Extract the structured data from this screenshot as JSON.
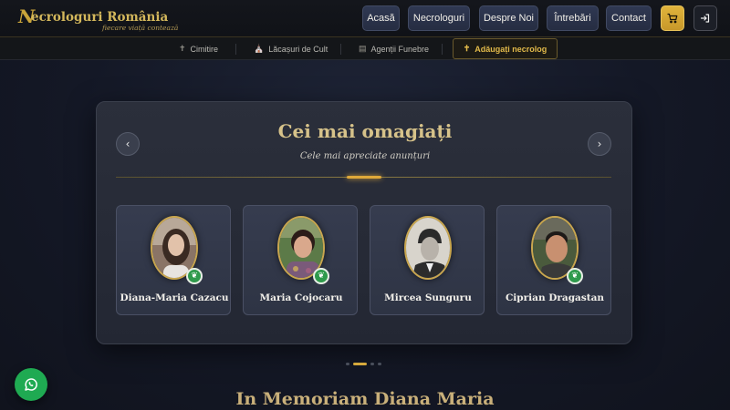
{
  "brand": {
    "initial": "N",
    "title": "ecrologuri România",
    "tagline": "fiecare viață contează"
  },
  "nav": {
    "items": [
      "Acasă",
      "Necrologuri",
      "Despre Noi",
      "Întrebări",
      "Contact"
    ]
  },
  "subnav": {
    "items": [
      {
        "label": "Cimitire",
        "icon": "cross-icon"
      },
      {
        "label": "Lăcașuri de Cult",
        "icon": "church-icon"
      },
      {
        "label": "Agenții Funebre",
        "icon": "building-icon"
      }
    ],
    "cta": {
      "label": "Adăugați necrolog",
      "icon": "cross-icon"
    }
  },
  "section": {
    "title": "Cei mai omagiați",
    "subtitle": "Cele mai apreciate anunțuri"
  },
  "cards": [
    {
      "name": "Diana-Maria Cazacu",
      "badge": true
    },
    {
      "name": "Maria Cojocaru",
      "badge": true
    },
    {
      "name": "Mircea Sunguru",
      "badge": false
    },
    {
      "name": "Ciprian Dragastan",
      "badge": true
    }
  ],
  "carousel": {
    "pages": 4,
    "active_page": 2
  },
  "next_heading": "In Memoriam Diana Maria",
  "colors": {
    "accent_gold": "#d6a93c",
    "badge_green": "#2f9a4c",
    "whatsapp_green": "#1faa52"
  }
}
